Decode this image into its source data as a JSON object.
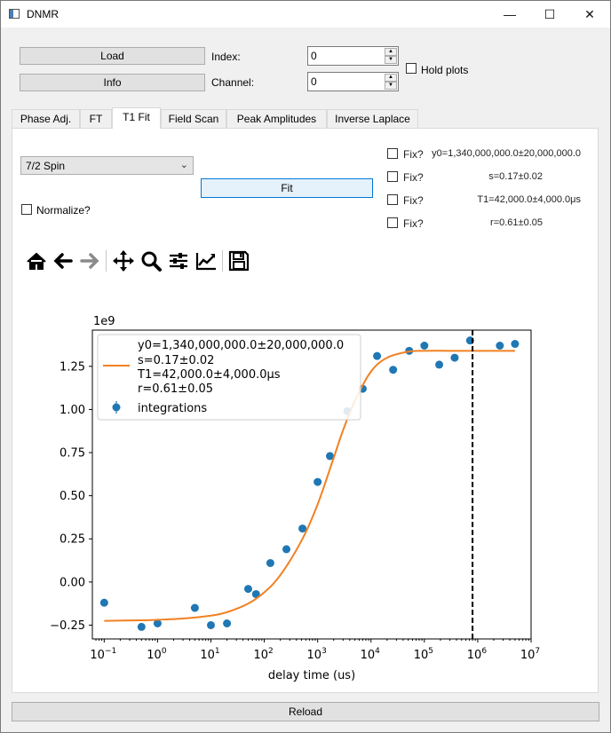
{
  "window": {
    "title": "DNMR",
    "minimize_glyph": "—",
    "maximize_glyph": "☐",
    "close_glyph": "✕"
  },
  "controls": {
    "load_label": "Load",
    "info_label": "Info",
    "index_label": "Index:",
    "index_value": "0",
    "channel_label": "Channel:",
    "channel_value": "0",
    "hold_plots_label": "Hold plots"
  },
  "tabs": [
    {
      "label": "Phase Adj."
    },
    {
      "label": "FT"
    },
    {
      "label": "T1 Fit"
    },
    {
      "label": "Field Scan"
    },
    {
      "label": "Peak Amplitudes"
    },
    {
      "label": "Inverse Laplace"
    }
  ],
  "active_tab": "T1 Fit",
  "t1fit": {
    "spin_select": "7/2 Spin",
    "fit_label": "Fit",
    "normalize_label": "Normalize?",
    "fix_rows": [
      {
        "label": "Fix?",
        "value": "y0=1,340,000,000.0±20,000,000.0"
      },
      {
        "label": "Fix?",
        "value": "s=0.17±0.02"
      },
      {
        "label": "Fix?",
        "value": "T1=42,000.0±4,000.0μs"
      },
      {
        "label": "Fix?",
        "value": "r=0.61±0.05"
      }
    ]
  },
  "toolbar_icons": [
    "home-icon",
    "back-arrow-icon",
    "forward-arrow-icon",
    "pan-icon",
    "zoom-icon",
    "configure-subplots-icon",
    "edit-axis-icon",
    "save-icon"
  ],
  "colors": {
    "fit_line": "#f28022",
    "points": "#1f77b4"
  },
  "chart_data": {
    "type": "scatter",
    "title": "",
    "xlabel": "delay time (us)",
    "ylabel": "",
    "y_offset_text": "1e9",
    "x_scale": "log",
    "xlim": [
      0.06,
      10000000
    ],
    "ylim": [
      -0.33,
      1.46
    ],
    "x_ticks": [
      {
        "value": 0.1,
        "base": "10",
        "exp": "−1"
      },
      {
        "value": 1,
        "base": "10",
        "exp": "0"
      },
      {
        "value": 10,
        "base": "10",
        "exp": "1"
      },
      {
        "value": 100,
        "base": "10",
        "exp": "2"
      },
      {
        "value": 1000,
        "base": "10",
        "exp": "3"
      },
      {
        "value": 10000,
        "base": "10",
        "exp": "4"
      },
      {
        "value": 100000,
        "base": "10",
        "exp": "5"
      },
      {
        "value": 1000000,
        "base": "10",
        "exp": "6"
      },
      {
        "value": 10000000,
        "base": "10",
        "exp": "7"
      }
    ],
    "y_ticks": [
      {
        "value": -0.25,
        "label": "−0.25"
      },
      {
        "value": 0.0,
        "label": "0.00"
      },
      {
        "value": 0.25,
        "label": "0.25"
      },
      {
        "value": 0.5,
        "label": "0.50"
      },
      {
        "value": 0.75,
        "label": "0.75"
      },
      {
        "value": 1.0,
        "label": "1.00"
      },
      {
        "value": 1.25,
        "label": "1.25"
      }
    ],
    "legend": {
      "placement": "upper left",
      "entries": [
        {
          "kind": "line",
          "lines": [
            "y0=1,340,000,000.0±20,000,000.0",
            "s=0.17±0.02",
            "T1=42,000.0±4,000.0μs",
            "r=0.61±0.05"
          ]
        },
        {
          "kind": "marker",
          "lines": [
            "integrations"
          ]
        }
      ]
    },
    "vline_x": 800000,
    "series": [
      {
        "name": "integrations",
        "kind": "points",
        "x": [
          0.1,
          0.5,
          1,
          5,
          10,
          20,
          50,
          70,
          130,
          260,
          520,
          1000,
          1700,
          3600,
          7000,
          13000,
          26000,
          52000,
          100000,
          190000,
          370000,
          720000,
          2600000,
          5000000
        ],
        "y": [
          -0.12,
          -0.26,
          -0.24,
          -0.15,
          -0.25,
          -0.24,
          -0.04,
          -0.07,
          0.11,
          0.19,
          0.31,
          0.58,
          0.73,
          0.99,
          1.12,
          1.31,
          1.23,
          1.34,
          1.37,
          1.26,
          1.3,
          1.4,
          1.37,
          1.38
        ]
      },
      {
        "name": "y0=1,340,000,000.0±20,000,000.0 s=0.17±0.02 T1=42,000.0±4,000.0μs r=0.61±0.05",
        "kind": "line",
        "x": [
          0.1,
          0.5,
          1,
          3,
          10,
          20,
          50,
          100,
          200,
          500,
          1000,
          2000,
          3000,
          5000,
          10000,
          20000,
          50000,
          100000,
          300000,
          1000000,
          5000000
        ],
        "y": [
          -0.225,
          -0.222,
          -0.219,
          -0.212,
          -0.195,
          -0.175,
          -0.125,
          -0.06,
          0.04,
          0.24,
          0.45,
          0.72,
          0.88,
          1.05,
          1.22,
          1.3,
          1.335,
          1.34,
          1.34,
          1.34,
          1.34
        ]
      }
    ]
  },
  "reload_label": "Reload"
}
